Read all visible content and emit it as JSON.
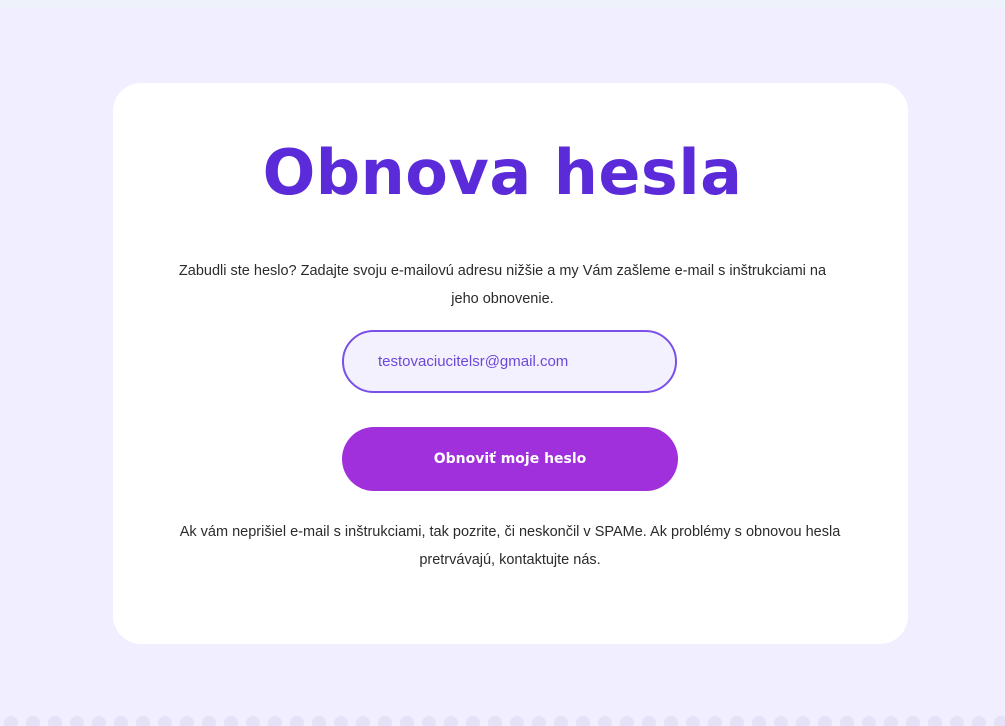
{
  "page": {
    "title": "Obnova hesla",
    "intro": "Zabudli ste heslo? Zadajte svoju e-mailovú adresu nižšie a my Vám zašleme e-mail s inštrukciami na jeho obnovenie.",
    "email": {
      "value": "testovaciucitelsr@gmail.com",
      "placeholder": ""
    },
    "submit_label": "Obnoviť moje heslo",
    "note": "Ak vám neprišiel e-mail s inštrukciami, tak pozrite, či neskončil v SPAMe. Ak problémy s obnovou hesla pretrvávajú, kontaktujte nás."
  },
  "colors": {
    "background": "#f1eeff",
    "card": "#ffffff",
    "title": "#5b2bd9",
    "input_border": "#7a50e8",
    "input_text": "#6b48d8",
    "button": "#a030dc",
    "button_text": "#ffffff"
  }
}
